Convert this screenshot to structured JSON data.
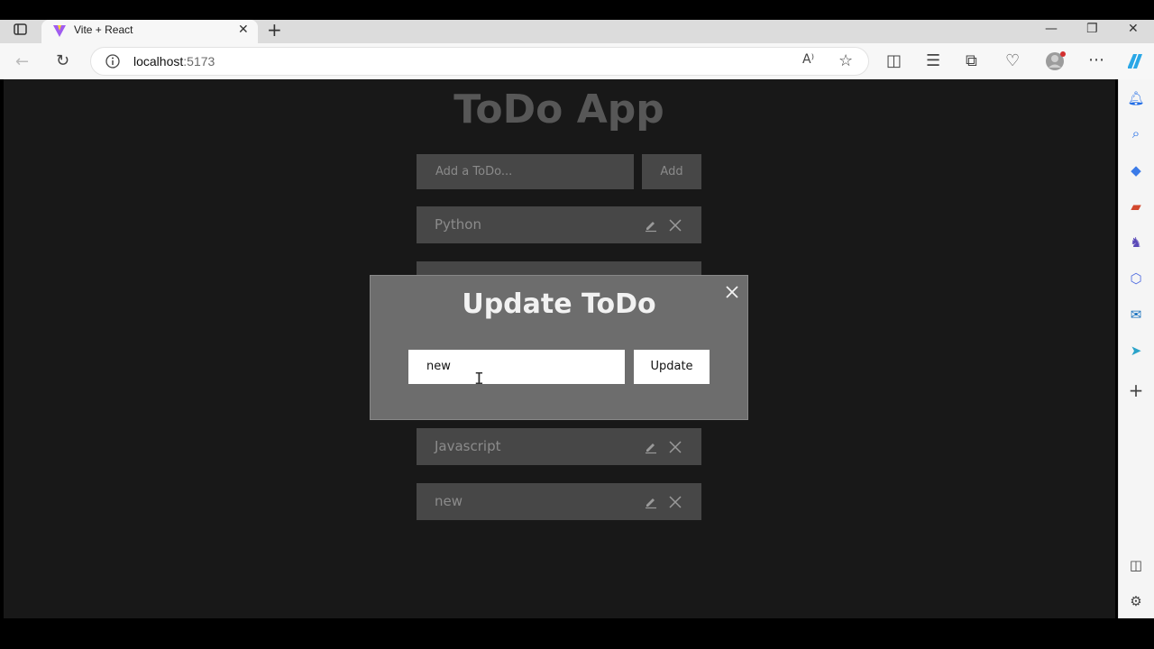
{
  "browser": {
    "tab_title": "Vite + React",
    "url_host": "localhost",
    "url_port": ":5173"
  },
  "app": {
    "title": "ToDo App",
    "add_placeholder": "Add a ToDo...",
    "add_label": "Add",
    "todos": [
      {
        "text": "Python"
      },
      {
        "text": ""
      },
      {
        "text": "Javascript"
      },
      {
        "text": "new"
      }
    ]
  },
  "modal": {
    "title": "Update ToDo",
    "input_value": "new",
    "update_label": "Update"
  },
  "colors": {
    "page_bg": "#181818",
    "item_bg": "#474747",
    "modal_bg": "#6d6d6d"
  }
}
